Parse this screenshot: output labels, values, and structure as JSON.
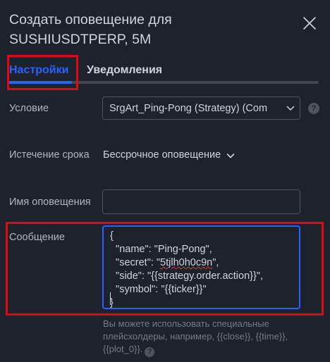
{
  "dialog": {
    "title_line1": "Создать оповещение для",
    "title_line2": "SUSHIUSDTPERP, 5M"
  },
  "tabs": [
    {
      "label": "Настройки",
      "active": true
    },
    {
      "label": "Уведомления",
      "active": false
    }
  ],
  "condition": {
    "label": "Условие",
    "value": "SrgArt_Ping-Pong (Strategy) (Com",
    "help_glyph": "?"
  },
  "expiration": {
    "label": "Истечение срока",
    "value": "Бессрочное оповещение"
  },
  "alert_name": {
    "label": "Имя оповещения",
    "value": "",
    "placeholder": ""
  },
  "message": {
    "label": "Сообщение",
    "lines": {
      "l1": "{",
      "l2": "  \"name\": \"Ping-Pong\",",
      "l3_pre": "  \"secret\": \"",
      "l3_secret": "5tjlh0h0c9n",
      "l3_post": "\",",
      "l4": "  \"side\": \"{{strategy.order.action}}\",",
      "l5": "  \"symbol\": \"{{ticker}}\"",
      "l6": "}"
    }
  },
  "hint": {
    "text": "Вы можете использовать специальные плейсхолдеры, например, {{close}}, {{time}}, {{plot_0}}.",
    "help_glyph": "?"
  },
  "colors": {
    "background": "#1e222d",
    "accent": "#2962ff",
    "highlight": "#e30613",
    "text": "#d1d4dc",
    "muted": "#787b86"
  },
  "icons": {
    "close": "close-icon",
    "chevron": "chevron-down-icon",
    "help": "help-icon"
  }
}
